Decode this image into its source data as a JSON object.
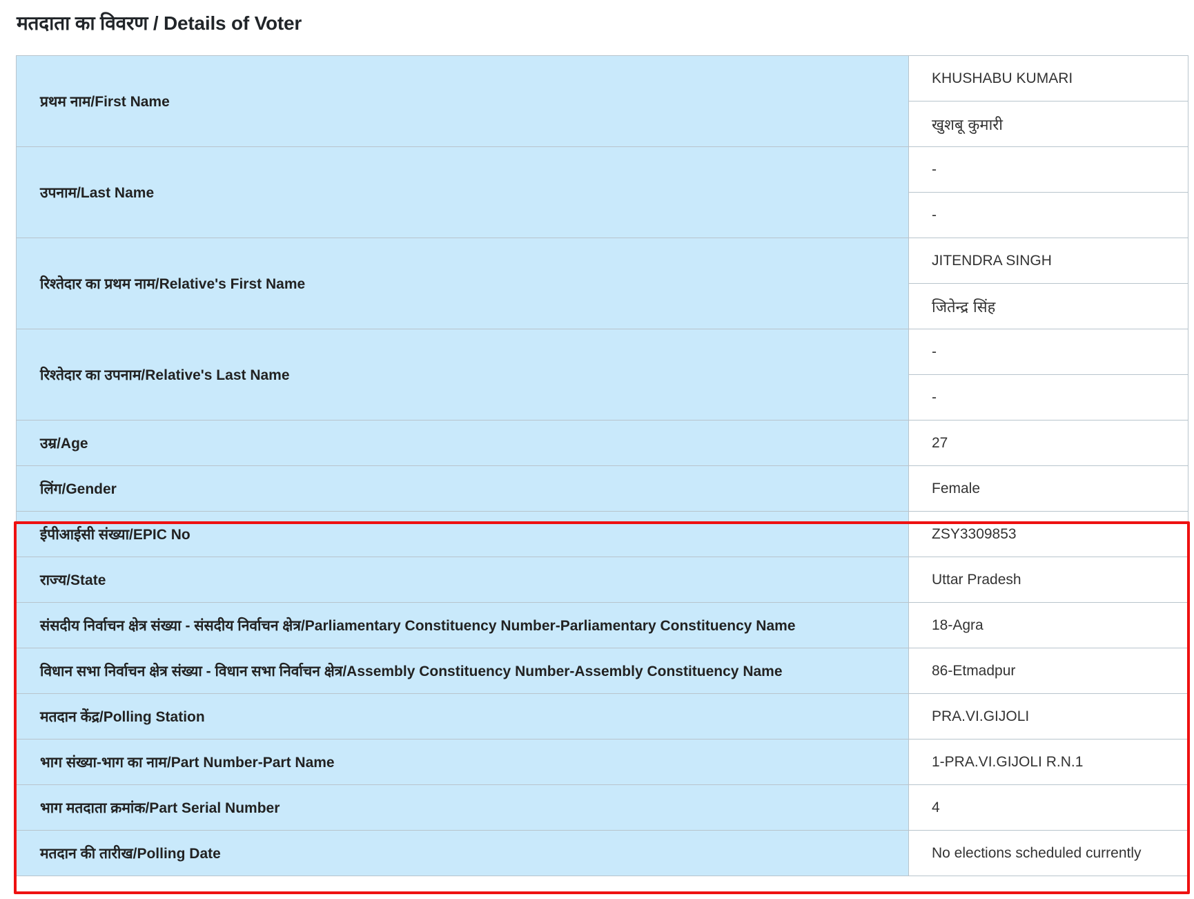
{
  "page": {
    "title": "मतदाता का विवरण / Details of Voter"
  },
  "colors": {
    "label_background": "#c9e9fb",
    "highlight_border": "#ee1111",
    "cell_border": "#b8c4cc"
  },
  "fields": {
    "first_name": {
      "label": "प्रथम नाम/First Name",
      "value_en": "KHUSHABU KUMARI",
      "value_hi": "खुशबू कुमारी"
    },
    "last_name": {
      "label": "उपनाम/Last Name",
      "value_en": "-",
      "value_hi": "-"
    },
    "relative_first_name": {
      "label": "रिश्तेदार का प्रथम नाम/Relative's First Name",
      "value_en": "JITENDRA SINGH",
      "value_hi": "जितेन्द्र सिंह"
    },
    "relative_last_name": {
      "label": "रिश्तेदार का उपनाम/Relative's Last Name",
      "value_en": "-",
      "value_hi": "-"
    },
    "age": {
      "label": "उम्र/Age",
      "value": "27"
    },
    "gender": {
      "label": "लिंग/Gender",
      "value": "Female"
    },
    "epic_no": {
      "label": "ईपीआईसी संख्या/EPIC No",
      "value": "ZSY3309853"
    },
    "state": {
      "label": "राज्य/State",
      "value": "Uttar Pradesh"
    },
    "parliamentary_constituency": {
      "label": "संसदीय निर्वाचन क्षेत्र संख्या - संसदीय निर्वाचन क्षेत्र/Parliamentary Constituency Number-Parliamentary Constituency Name",
      "value": "18-Agra"
    },
    "assembly_constituency": {
      "label": "विधान सभा निर्वाचन क्षेत्र संख्या - विधान सभा निर्वाचन क्षेत्र/Assembly Constituency Number-Assembly Constituency Name",
      "value": "86-Etmadpur"
    },
    "polling_station": {
      "label": "मतदान केंद्र/Polling Station",
      "value": "PRA.VI.GIJOLI"
    },
    "part": {
      "label": "भाग संख्या-भाग का नाम/Part Number-Part Name",
      "value": "1-PRA.VI.GIJOLI R.N.1"
    },
    "part_serial_number": {
      "label": "भाग मतदाता क्रमांक/Part Serial Number",
      "value": "4"
    },
    "polling_date": {
      "label": "मतदान की तारीख/Polling Date",
      "value": "No elections scheduled currently"
    }
  }
}
